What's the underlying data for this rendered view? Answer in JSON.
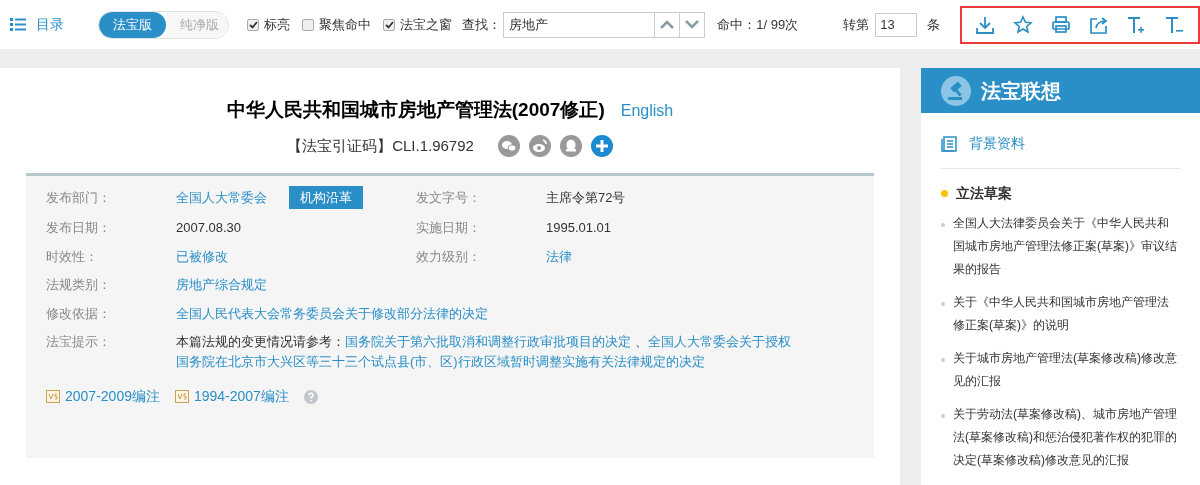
{
  "toolbar": {
    "toc_label": "目录",
    "versions": [
      {
        "label": "法宝版",
        "selected": true
      },
      {
        "label": "纯净版",
        "selected": false
      }
    ],
    "options": [
      {
        "label": "标亮",
        "checked": true
      },
      {
        "label": "聚焦命中",
        "checked": false
      },
      {
        "label": "法宝之窗",
        "checked": true
      }
    ],
    "search_label": "查找：",
    "search_value": "房地产",
    "hits": "命中：1/ 99次",
    "goto_label": "转第",
    "goto_value": "13",
    "goto_unit": "条",
    "actions": [
      {
        "kind": "download"
      },
      {
        "kind": "star"
      },
      {
        "kind": "print"
      },
      {
        "kind": "share"
      },
      {
        "kind": "font-up"
      },
      {
        "kind": "font-down"
      }
    ]
  },
  "document": {
    "title": "中华人民共和国城市房地产管理法(2007修正)",
    "english_link": "English",
    "citation": "【法宝引证码】CLI.1.96792",
    "share": [
      {
        "kind": "wechat"
      },
      {
        "kind": "weibo"
      },
      {
        "kind": "qq"
      },
      {
        "kind": "more"
      }
    ],
    "fields": [
      {
        "label": "发布部门：",
        "value": "全国人大常委会",
        "link": true,
        "button": "机构沿革"
      },
      {
        "label": "发文字号：",
        "value": "主席令第72号",
        "link": false
      },
      {
        "label": "发布日期：",
        "value": "2007.08.30",
        "link": false
      },
      {
        "label": "实施日期：",
        "value": "1995.01.01",
        "link": false
      },
      {
        "label": "时效性：",
        "value": "已被修改",
        "link": true
      },
      {
        "label": "效力级别：",
        "value": "法律",
        "link": true
      },
      {
        "label": "法规类别：",
        "value": "房地产综合规定",
        "link": true,
        "wide": true
      },
      {
        "label": "修改依据：",
        "value": "全国人民代表大会常务委员会关于修改部分法律的决定",
        "link": true,
        "wide": true
      }
    ],
    "hint": {
      "label": "法宝提示：",
      "parts": [
        {
          "text": "本篇法规的变更情况请参考：",
          "link": false,
          "new_line": false
        },
        {
          "text": "国务院关于第六批取消和调整行政审批项目的决定",
          "link": true,
          "new_line": false
        },
        {
          "text": " 、",
          "link": false,
          "new_line": false
        },
        {
          "text": "全国人大常委会关于授权",
          "link": true,
          "new_line": false
        },
        {
          "text": "国务院在北京市大兴区等三十三个试点县(市、区)行政区域暂时调整实施有关法律规定的决定",
          "link": true,
          "new_line": true
        }
      ]
    },
    "notes": [
      "2007-2009编注",
      "1994-2007编注"
    ]
  },
  "sidebar": {
    "title": "法宝联想",
    "section": "背景资料",
    "group": "立法草案",
    "items": [
      "全国人大法律委员会关于《中华人民共和国城市房地产管理法修正案(草案)》审议结果的报告",
      "关于《中华人民共和国城市房地产管理法修正案(草案)》的说明",
      "关于城市房地产管理法(草案修改稿)修改意见的汇报",
      "关于劳动法(草案修改稿)、城市房地产管理法(草案修改稿)和惩治侵犯著作权的犯罪的决定(草案修改稿)修改意见的汇报"
    ]
  }
}
